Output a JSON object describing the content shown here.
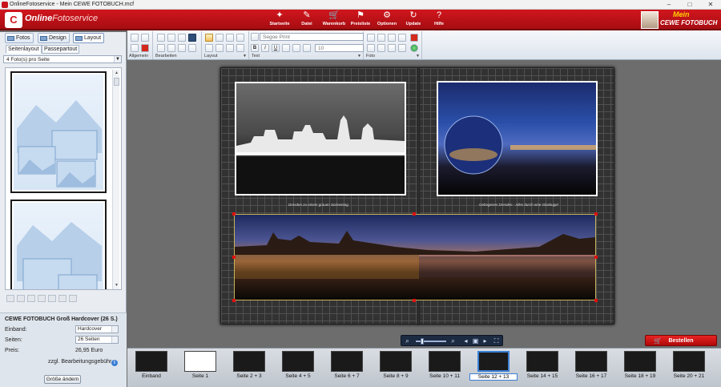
{
  "window": {
    "title": "OnlineFotoservice - Mein CEWE FOTOBUCH.mcf",
    "minimize": "–",
    "maximize": "□",
    "close": "✕"
  },
  "logo": {
    "icon": "C",
    "text_bold": "Online",
    "text_light": "Fotoservice"
  },
  "nav": [
    {
      "label": "Startseite",
      "icon": "✦"
    },
    {
      "label": "Datei",
      "icon": "✎"
    },
    {
      "label": "Warenkorb",
      "icon": "🛒"
    },
    {
      "label": "Preisliste",
      "icon": "⚑"
    },
    {
      "label": "Optionen",
      "icon": "⚙"
    },
    {
      "label": "Update",
      "icon": "↻"
    },
    {
      "label": "Hilfe",
      "icon": "?"
    }
  ],
  "brand": {
    "line1": "Mein",
    "line2": "CEWE FOTOBUCH"
  },
  "tabs": [
    {
      "label": "Fotos"
    },
    {
      "label": "Design"
    },
    {
      "label": "Layout"
    }
  ],
  "subtabs": [
    {
      "label": "Seitenlayout"
    },
    {
      "label": "Passepartout"
    }
  ],
  "layout_select": "4 Foto(s) pro Seite",
  "ribbon": {
    "groups": [
      "Allgemein",
      "Bearbeiten",
      "Layout",
      "Text",
      "Foto"
    ],
    "font": "Segoe Print",
    "font_size": "10",
    "text_buttons": [
      "B",
      "I",
      "U"
    ]
  },
  "order": {
    "title": "CEWE FOTOBUCH Groß Hardcover (26 S.)",
    "binding_label": "Einband:",
    "binding_value": "Hardcover",
    "pages_label": "Seiten:",
    "pages_value": "26 Seiten",
    "price_label": "Preis:",
    "price_value": "26,95 Euro",
    "fee_note": "zzgl. Bearbeitungsgebühr",
    "resize_button": "Größe ändern"
  },
  "spread": {
    "caption1": "Dresden zu einem grauen Sonnentag",
    "caption2": "Gebogenes Dresden - Alles durch eine Glaskugel"
  },
  "order_button": "Bestellen",
  "filmstrip": [
    {
      "label": "Einband"
    },
    {
      "label": "Seite 1"
    },
    {
      "label": "Seite 2 + 3"
    },
    {
      "label": "Seite 4 + 5"
    },
    {
      "label": "Seite 6 + 7"
    },
    {
      "label": "Seite 8 + 9"
    },
    {
      "label": "Seite 10 + 11"
    },
    {
      "label": "Seite 12 + 13"
    },
    {
      "label": "Seite 14 + 15"
    },
    {
      "label": "Seite 16 + 17"
    },
    {
      "label": "Seite 18 + 19"
    },
    {
      "label": "Seite 20 + 21"
    }
  ],
  "colors": {
    "brand_red": "#d1161d",
    "accent_blue": "#3a7fd5"
  }
}
